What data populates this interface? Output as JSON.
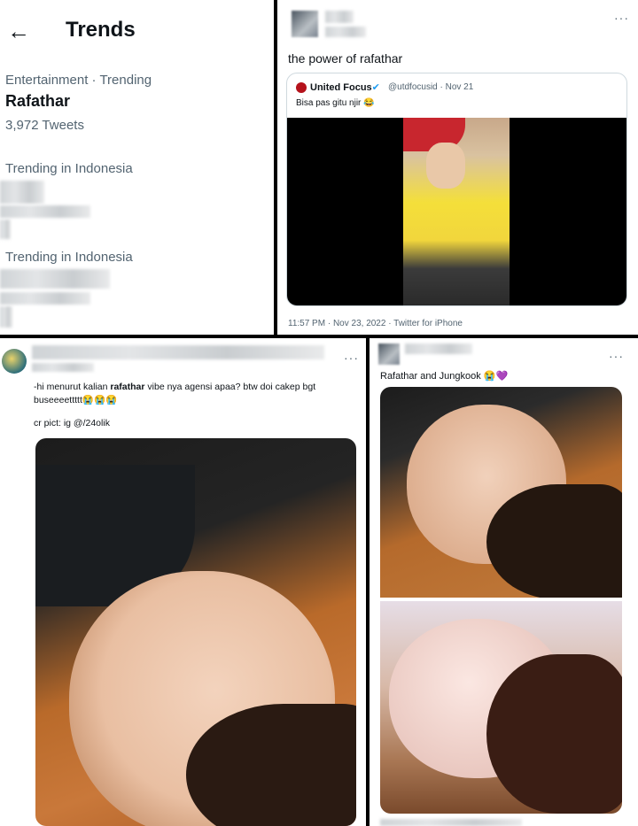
{
  "trends_panel": {
    "title": "Trends",
    "back_icon": "arrow-left-icon",
    "trend_meta": "Entertainment · Trending",
    "trend_name": "Rafathar",
    "trend_count": "3,972 Tweets",
    "section1_label": "Trending in Indonesia",
    "section2_label": "Trending in Indonesia"
  },
  "tweet1": {
    "more": "···",
    "text": "the power of rafathar",
    "quote": {
      "name": "United Focus",
      "badge_icon": "verified-badge-icon",
      "handle_date": "@utdfocusid · Nov 21",
      "text": "Bisa pas gitu njir 😂"
    },
    "footer": "11:57 PM · Nov 23, 2022 · Twitter for iPhone"
  },
  "tweet2": {
    "more": "···",
    "text_before": "-hi menurut kalian ",
    "text_bold": "rafathar",
    "text_after": " vibe nya agensi apaa? btw doi cakep bgt buseeeettttt😭😭😭",
    "credit": "cr pict: ig @/24olik"
  },
  "tweet3": {
    "more": "···",
    "text": "Rafathar and Jungkook 😭💜"
  },
  "colors": {
    "accent": "#1d9bf0",
    "secondary_text": "#536471",
    "border": "#cfd9de"
  }
}
